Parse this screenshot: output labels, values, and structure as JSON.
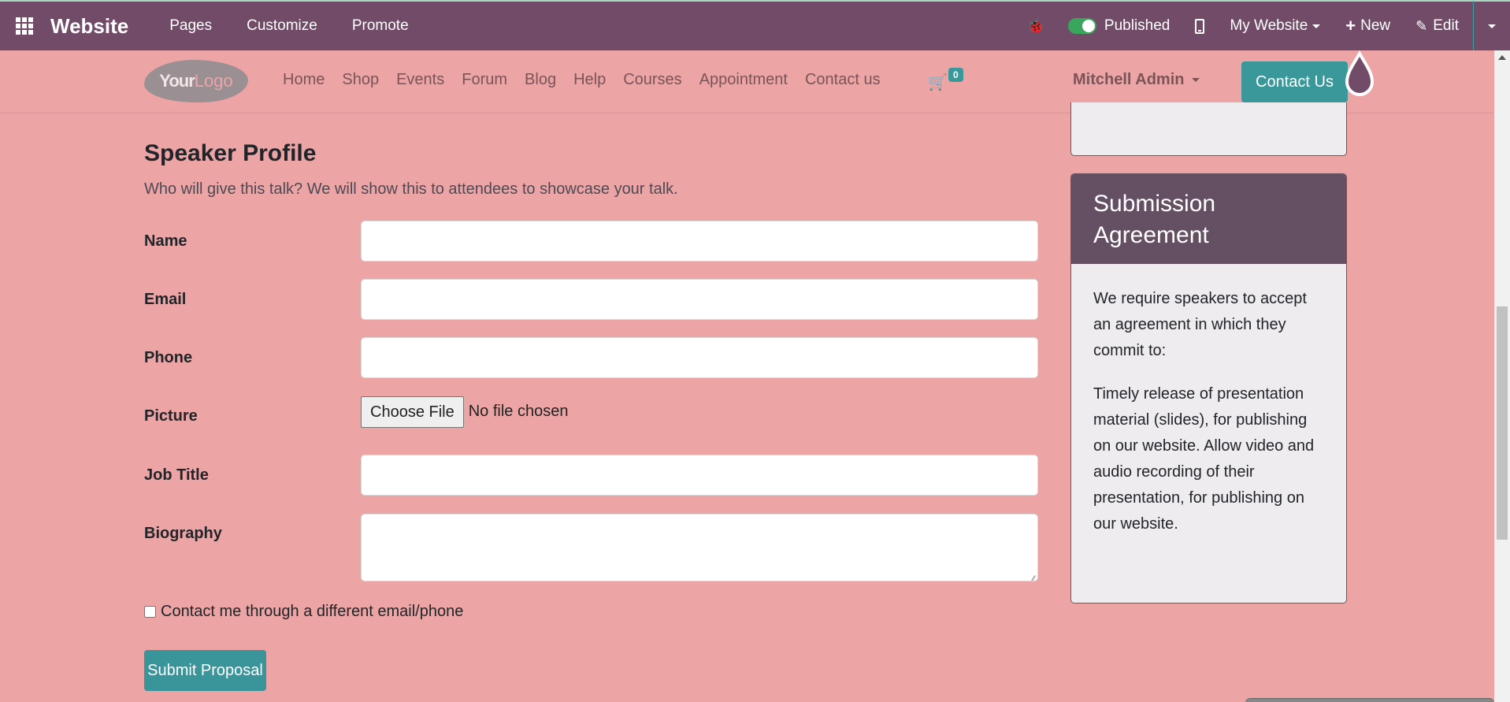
{
  "topbar": {
    "brand": "Website",
    "menu": [
      "Pages",
      "Customize",
      "Promote"
    ],
    "published_label": "Published",
    "published_on": true,
    "website_selector": "My Website",
    "new_label": "New",
    "edit_label": "Edit"
  },
  "header": {
    "logo_your": "Your",
    "logo_logo": "Logo",
    "nav": [
      "Home",
      "Shop",
      "Events",
      "Forum",
      "Blog",
      "Help",
      "Courses",
      "Appointment",
      "Contact us"
    ],
    "cart_count": "0",
    "user_name": "Mitchell Admin",
    "contact_button": "Contact Us"
  },
  "form": {
    "title": "Speaker Profile",
    "subtitle": "Who will give this talk? We will show this to attendees to showcase your talk.",
    "fields": {
      "name": {
        "label": "Name",
        "value": ""
      },
      "email": {
        "label": "Email",
        "value": ""
      },
      "phone": {
        "label": "Phone",
        "value": ""
      },
      "picture": {
        "label": "Picture",
        "button": "Choose File",
        "status": "No file chosen"
      },
      "job_title": {
        "label": "Job Title",
        "value": ""
      },
      "biography": {
        "label": "Biography",
        "value": ""
      }
    },
    "checkbox_label": "Contact me through a different email/phone",
    "checkbox_checked": false,
    "submit_label": "Submit Proposal"
  },
  "sidebar": {
    "agreement_title": "Submission Agreement",
    "agreement_intro": "We require speakers to accept an agreement in which they commit to:",
    "agreement_terms": "Timely release of presentation material (slides), for publishing on our website. Allow video and audio recording of their presentation, for publishing on our website."
  },
  "colors": {
    "admin_bar": "#714b67",
    "page_background": "#eda4a5",
    "accent": "#3a989b",
    "card_header": "#654f63"
  }
}
